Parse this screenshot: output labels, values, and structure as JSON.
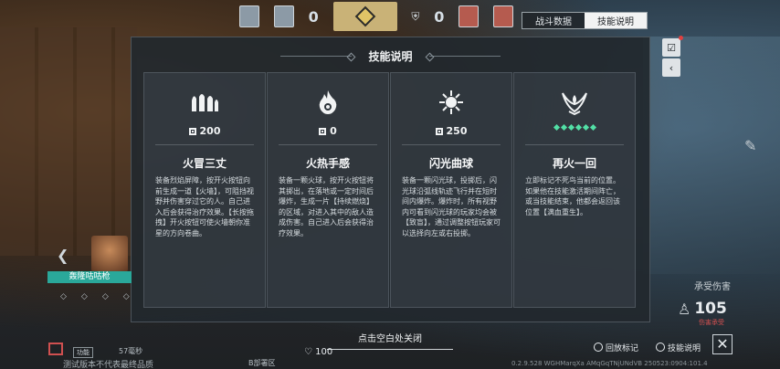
{
  "hud": {
    "score_left": "0",
    "score_right": "0"
  },
  "tabs": [
    {
      "label": "战斗数据",
      "active": false
    },
    {
      "label": "技能说明",
      "active": true
    }
  ],
  "modal": {
    "title": "技能说明",
    "close_hint": "点击空白处关闭",
    "cards": [
      {
        "icon": "flame-wall-icon",
        "cost": "200",
        "name": "火冒三丈",
        "desc": "装备烈焰屏障，按开火按钮向前生成一道【火墙】，可阻挡视野并伤害穿过它的人。自己进入后会获得治疗效果。【长按拖拽】开火按钮可使火墙朝你准星的方向卷曲。"
      },
      {
        "icon": "fireball-icon",
        "cost": "0",
        "name": "火热手感",
        "desc": "装备一颗火球，按开火按钮将其掷出，在落地或一定时间后爆炸，生成一片【持续燃烧】的区域，对进入其中的敌人造成伤害。自己进入后会获得治疗效果。"
      },
      {
        "icon": "flash-orb-icon",
        "cost": "250",
        "name": "闪光曲球",
        "desc": "装备一颗闪光球，投掷后，闪光球沿弧线轨迹飞行并在短时间内爆炸。爆炸时，所有视野内可看到闪光球的玩家均会被【致盲】，通过调整按钮玩家可以选择向左或右投掷。"
      },
      {
        "icon": "phoenix-rebirth-icon",
        "cost": "",
        "cost_dots": 6,
        "name": "再火一回",
        "desc": "立即标记不死鸟当前的位置。如果他在技能激活期间阵亡，或当技能结束，他都会返回该位置【满血重生】。"
      }
    ]
  },
  "player": {
    "name": "轰隆咕咕枪"
  },
  "damage": {
    "label": "承受伤害",
    "hp": "105",
    "sub": "伤害承受"
  },
  "bottom": {
    "ping_chip": "功能",
    "ping": "57毫秒",
    "disclaimer": "测试版本不代表最终品质",
    "zone": "B部署区",
    "hp": "100",
    "replay_button": "回放标记",
    "skills_button": "技能说明",
    "version": "0.2.9.528 WGHMarqXa AMqGqTNjUNdVB 250523:0904:101.4"
  },
  "colors": {
    "accent_teal": "#2aa89a",
    "ultimate_dot": "#52e0a6",
    "alert_red": "#e04040"
  }
}
